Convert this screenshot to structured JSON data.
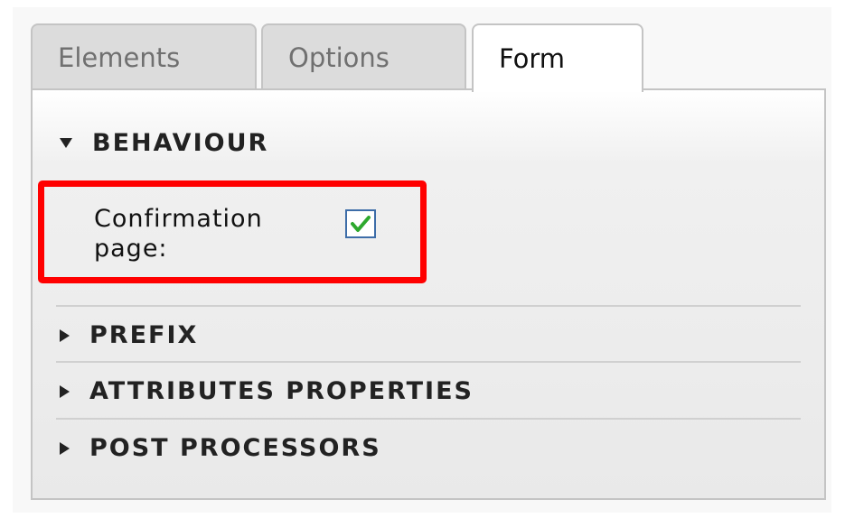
{
  "tabs": [
    {
      "label": "Elements",
      "active": false
    },
    {
      "label": "Options",
      "active": false
    },
    {
      "label": "Form",
      "active": true
    }
  ],
  "sections": [
    {
      "label": "BEHAVIOUR",
      "expanded": true
    },
    {
      "label": "PREFIX",
      "expanded": false
    },
    {
      "label": "ATTRIBUTES PROPERTIES",
      "expanded": false
    },
    {
      "label": "POST PROCESSORS",
      "expanded": false
    }
  ],
  "behaviour": {
    "confirmation_label": "Confirmation page:",
    "confirmation_checked": true
  },
  "colors": {
    "highlight": "#ff0000",
    "checkmark": "#2da82d",
    "checkbox_border": "#3d6da8"
  }
}
